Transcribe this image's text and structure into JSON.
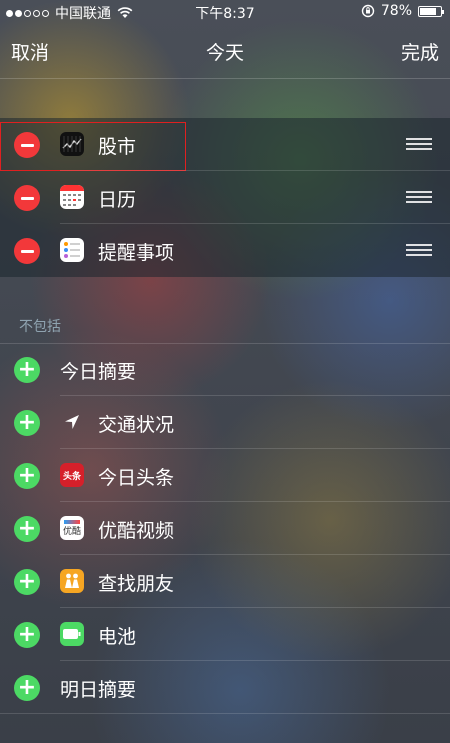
{
  "status_bar": {
    "carrier": "中国联通",
    "time": "下午8:37",
    "battery_percent": "78%",
    "battery_level": 0.78,
    "signal_bars_filled": 2,
    "signal_bars_total": 5
  },
  "nav": {
    "cancel_label": "取消",
    "title": "今天",
    "done_label": "完成"
  },
  "included_widgets": [
    {
      "label": "股市",
      "icon": "stocks-icon",
      "highlighted": true
    },
    {
      "label": "日历",
      "icon": "calendar-icon",
      "highlighted": false
    },
    {
      "label": "提醒事项",
      "icon": "reminders-icon",
      "highlighted": false
    }
  ],
  "excluded_section": {
    "header": "不包括",
    "items": [
      {
        "label": "今日摘要",
        "icon": ""
      },
      {
        "label": "交通状况",
        "icon": "location-arrow-icon"
      },
      {
        "label": "今日头条",
        "icon": "toutiao-icon",
        "icon_text": "头条"
      },
      {
        "label": "优酷视频",
        "icon": "youku-icon",
        "icon_text": "优酷"
      },
      {
        "label": "查找朋友",
        "icon": "find-friends-icon"
      },
      {
        "label": "电池",
        "icon": "battery-widget-icon"
      },
      {
        "label": "明日摘要",
        "icon": ""
      }
    ]
  },
  "colors": {
    "remove": "#f2383a",
    "add": "#4cd964",
    "highlight_border": "#e02020",
    "section_header": "#8fa3b0"
  }
}
